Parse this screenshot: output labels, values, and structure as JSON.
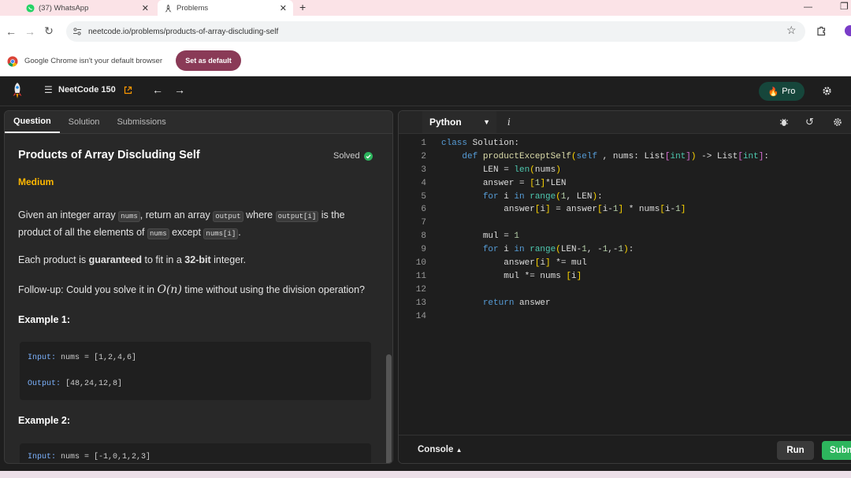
{
  "browser": {
    "tabs": [
      {
        "title": "(37) WhatsApp",
        "icon": "whatsapp-icon"
      },
      {
        "title": "Problems",
        "icon": "rocket-icon"
      }
    ],
    "new_tab_symbol": "+",
    "url": "neetcode.io/problems/products-of-array-discluding-self",
    "infobar_text": "Google Chrome isn't your default browser",
    "set_default_label": "Set as default"
  },
  "app": {
    "list_name": "NeetCode 150",
    "pro_label": "Pro"
  },
  "left_tabs": [
    "Question",
    "Solution",
    "Submissions"
  ],
  "problem": {
    "title": "Products of Array Discluding Self",
    "status": "Solved",
    "difficulty": "Medium",
    "difficulty_color": "#ffb800",
    "desc_given": "Given an integer array",
    "desc_nums": "nums",
    "desc_return": ", return an array",
    "desc_output": "output",
    "desc_where": "where",
    "desc_output_i": "output[i]",
    "desc_is_the": "is the",
    "desc_line2": "product of all the elements of",
    "desc_except": "except",
    "desc_nums_i": "nums[i]",
    "desc_period": ".",
    "guarantee_pre": "Each product is",
    "guarantee_bold": "guaranteed",
    "guarantee_mid": "to fit in a",
    "guarantee_bits": "32-bit",
    "guarantee_post": "integer.",
    "followup_pre": "Follow-up: Could you solve it in",
    "followup_math": "O(n)",
    "followup_post": "time without using the division operation?",
    "examples": [
      {
        "heading": "Example 1:",
        "input_label": "Input:",
        "input": "nums = [1,2,4,6]",
        "output_label": "Output:",
        "output": "[48,24,12,8]"
      },
      {
        "heading": "Example 2:",
        "input_label": "Input:",
        "input": "nums = [-1,0,1,2,3]"
      }
    ]
  },
  "editor": {
    "language": "Python",
    "info_glyph": "i",
    "console_label": "Console",
    "run_label": "Run",
    "submit_label": "Subm",
    "lines": [
      {
        "n": "1",
        "parts": [
          [
            "kw",
            "class"
          ],
          [
            "",
            "Solution:"
          ]
        ],
        "indent": 0
      },
      {
        "n": "2",
        "parts": [
          [
            "kw",
            "def"
          ],
          [
            "fn",
            "productExceptSelf"
          ],
          [
            "br",
            "("
          ],
          [
            "kw",
            "self"
          ],
          [
            "",
            ", nums: List"
          ],
          [
            "pu",
            "["
          ],
          [
            "bt",
            "int"
          ],
          [
            "pu",
            "]"
          ],
          [
            "br",
            ")"
          ],
          [
            "",
            ""
          ],
          [
            "",
            ""
          ],
          [
            "",
            "-> List"
          ],
          [
            "pu",
            "["
          ],
          [
            "bt",
            "int"
          ],
          [
            "pu",
            "]"
          ],
          [
            "",
            ":"
          ]
        ],
        "indent": 4
      },
      {
        "n": "3",
        "parts": [
          [
            "",
            "LEN = "
          ],
          [
            "bt",
            "len"
          ],
          [
            "br",
            "("
          ],
          [
            "",
            "nums"
          ],
          [
            "br",
            ")"
          ]
        ],
        "indent": 8
      },
      {
        "n": "4",
        "parts": [
          [
            "",
            "answer = "
          ],
          [
            "br",
            "["
          ],
          [
            "nu",
            "1"
          ],
          [
            "br",
            "]"
          ],
          [
            "",
            "*LEN"
          ]
        ],
        "indent": 8
      },
      {
        "n": "5",
        "parts": [
          [
            "kw",
            "for"
          ],
          [
            "",
            "i "
          ],
          [
            "kw",
            "in"
          ],
          [
            "bt",
            "range"
          ],
          [
            "br",
            "("
          ],
          [
            "nu",
            "1"
          ],
          [
            "",
            ", LEN"
          ],
          [
            "br",
            ")"
          ],
          [
            "",
            ":"
          ]
        ],
        "indent": 8
      },
      {
        "n": "6",
        "parts": [
          [
            "",
            "answer"
          ],
          [
            "br",
            "["
          ],
          [
            "",
            "i"
          ],
          [
            "br",
            "]"
          ],
          [
            "",
            ""
          ],
          [
            "",
            ""
          ],
          [
            "",
            "= answer"
          ],
          [
            "br",
            "["
          ],
          [
            "",
            "i-"
          ],
          [
            "nu",
            "1"
          ],
          [
            "br",
            "]"
          ],
          [
            "",
            ""
          ],
          [
            "",
            ""
          ],
          [
            "",
            "* nums"
          ],
          [
            "br",
            "["
          ],
          [
            "",
            "i-"
          ],
          [
            "nu",
            "1"
          ],
          [
            "br",
            "]"
          ]
        ],
        "indent": 12
      },
      {
        "n": "7",
        "parts": [],
        "indent": 0
      },
      {
        "n": "8",
        "parts": [
          [
            "",
            "mul = "
          ],
          [
            "nu",
            "1"
          ]
        ],
        "indent": 8
      },
      {
        "n": "9",
        "parts": [
          [
            "kw",
            "for"
          ],
          [
            "",
            "i "
          ],
          [
            "kw",
            "in"
          ],
          [
            "bt",
            "range"
          ],
          [
            "br",
            "("
          ],
          [
            "",
            "LEN-"
          ],
          [
            "nu",
            "1"
          ],
          [
            "",
            ", -"
          ],
          [
            "nu",
            "1"
          ],
          [
            "",
            ",-"
          ],
          [
            "nu",
            "1"
          ],
          [
            "br",
            ")"
          ],
          [
            "",
            ":"
          ]
        ],
        "indent": 8
      },
      {
        "n": "10",
        "parts": [
          [
            "",
            "answer"
          ],
          [
            "br",
            "["
          ],
          [
            "",
            "i"
          ],
          [
            "br",
            "]"
          ],
          [
            "",
            ""
          ],
          [
            "",
            ""
          ],
          [
            "",
            "*= mul"
          ]
        ],
        "indent": 12
      },
      {
        "n": "11",
        "parts": [
          [
            "",
            "mul *= nums "
          ],
          [
            "br",
            "["
          ],
          [
            "",
            "i"
          ],
          [
            "br",
            "]"
          ]
        ],
        "indent": 12
      },
      {
        "n": "12",
        "parts": [],
        "indent": 0
      },
      {
        "n": "13",
        "parts": [
          [
            "kw",
            "return"
          ],
          [
            "",
            "answer"
          ]
        ],
        "indent": 8
      },
      {
        "n": "14",
        "parts": [],
        "indent": 0
      }
    ]
  }
}
